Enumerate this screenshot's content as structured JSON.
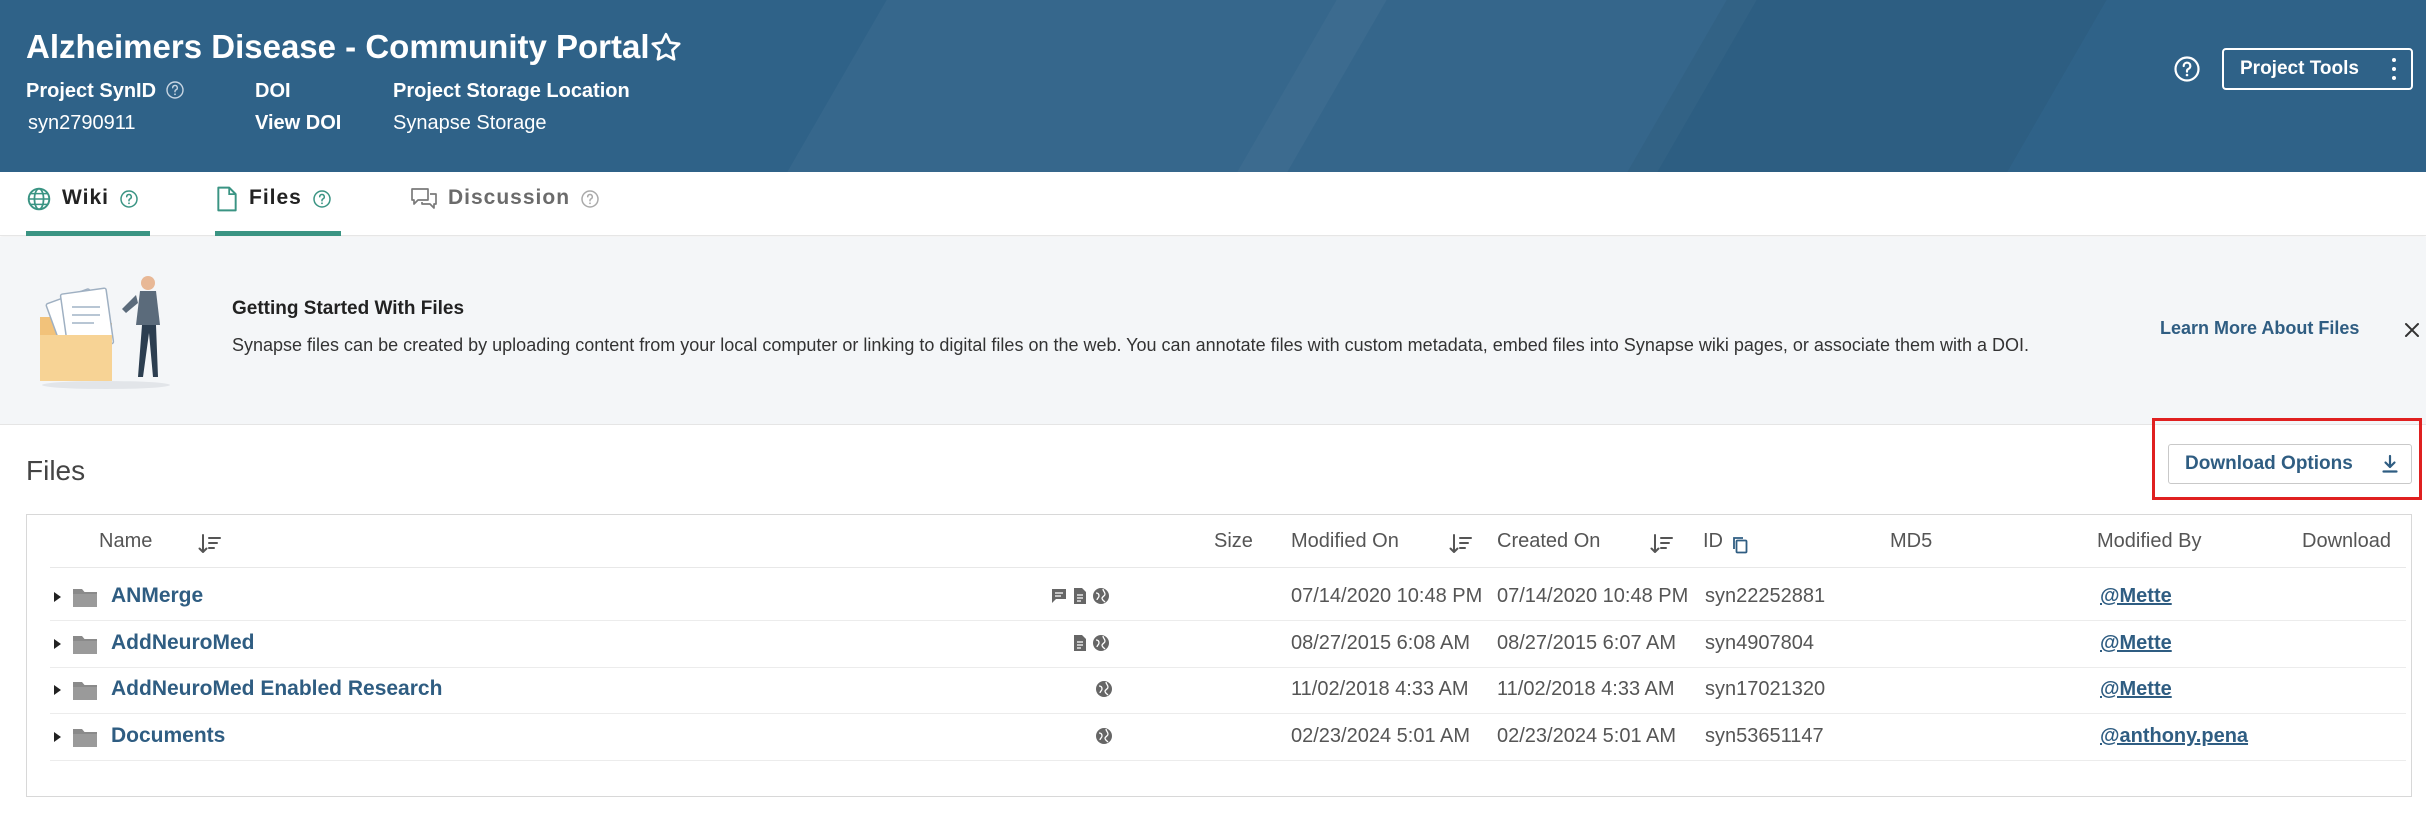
{
  "header": {
    "title": "Alzheimers Disease - Community Portal",
    "project_synid_label": "Project SynID",
    "project_synid_value": "syn2790911",
    "doi_label": "DOI",
    "doi_value": "View DOI",
    "storage_label": "Project Storage Location",
    "storage_value": "Synapse Storage",
    "project_tools_label": "Project Tools",
    "background_color": "#2f6288"
  },
  "tabs": [
    {
      "label": "Wiki",
      "icon": "globe-icon",
      "active": true
    },
    {
      "label": "Files",
      "icon": "file-icon",
      "active": true
    },
    {
      "label": "Discussion",
      "icon": "discussion-icon",
      "active": false
    }
  ],
  "banner": {
    "title": "Getting Started With Files",
    "text": "Synapse files can be created by uploading content from your local computer or linking to digital files on the web. You can annotate files with custom metadata, embed files into Synapse wiki pages, or associate them with a DOI.",
    "learn_more": "Learn More About Files"
  },
  "files": {
    "heading": "Files",
    "download_options_label": "Download Options",
    "columns": [
      "Name",
      "Size",
      "Modified On",
      "Created On",
      "ID",
      "MD5",
      "Modified By",
      "Download"
    ],
    "rows": [
      {
        "name": "ANMerge",
        "icons": [
          "comment-icon",
          "annotation-icon",
          "public-globe-icon"
        ],
        "size": "",
        "modified_on": "07/14/2020 10:48 PM",
        "created_on": "07/14/2020 10:48 PM",
        "id": "syn22252881",
        "md5": "",
        "modified_by": "@Mette"
      },
      {
        "name": "AddNeuroMed",
        "icons": [
          "annotation-icon",
          "public-globe-icon"
        ],
        "size": "",
        "modified_on": "08/27/2015 6:08 AM",
        "created_on": "08/27/2015 6:07 AM",
        "id": "syn4907804",
        "md5": "",
        "modified_by": "@Mette"
      },
      {
        "name": "AddNeuroMed Enabled Research",
        "icons": [
          "public-globe-icon"
        ],
        "size": "",
        "modified_on": "11/02/2018 4:33 AM",
        "created_on": "11/02/2018 4:33 AM",
        "id": "syn17021320",
        "md5": "",
        "modified_by": "@Mette"
      },
      {
        "name": "Documents",
        "icons": [
          "public-globe-icon"
        ],
        "size": "",
        "modified_on": "02/23/2024 5:01 AM",
        "created_on": "02/23/2024 5:01 AM",
        "id": "syn53651147",
        "md5": "",
        "modified_by": "@anthony.pena"
      }
    ]
  },
  "colors": {
    "accent": "#3a9483",
    "link": "#2f5d82",
    "highlight": "#e02020"
  }
}
